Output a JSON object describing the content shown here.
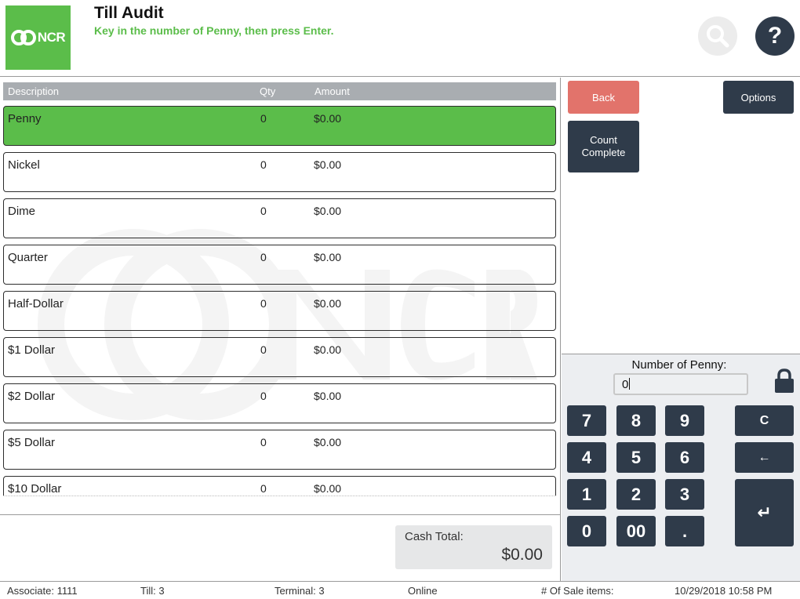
{
  "header": {
    "logo_text": "NCR",
    "title": "Till Audit",
    "subtitle": "Key in the number of Penny, then press Enter.",
    "search_icon": "search-icon",
    "help_label": "?"
  },
  "colors": {
    "brand_green": "#5bbd4a",
    "dark_button": "#2f3b4a",
    "back_button": "#e2736b"
  },
  "table": {
    "headers": {
      "description": "Description",
      "qty": "Qty",
      "amount": "Amount"
    },
    "rows": [
      {
        "description": "Penny",
        "qty": "0",
        "amount": "$0.00",
        "selected": true
      },
      {
        "description": "Nickel",
        "qty": "0",
        "amount": "$0.00"
      },
      {
        "description": "Dime",
        "qty": "0",
        "amount": "$0.00"
      },
      {
        "description": "Quarter",
        "qty": "0",
        "amount": "$0.00"
      },
      {
        "description": "Half-Dollar",
        "qty": "0",
        "amount": "$0.00"
      },
      {
        "description": "$1 Dollar",
        "qty": "0",
        "amount": "$0.00"
      },
      {
        "description": "$2 Dollar",
        "qty": "0",
        "amount": "$0.00"
      },
      {
        "description": "$5 Dollar",
        "qty": "0",
        "amount": "$0.00"
      },
      {
        "description": "$10 Dollar",
        "qty": "0",
        "amount": "$0.00"
      }
    ]
  },
  "totals": {
    "label": "Cash Total:",
    "value": "$0.00"
  },
  "actions": {
    "back": "Back",
    "options": "Options",
    "count_complete": "Count\nComplete"
  },
  "keypad": {
    "label": "Number of Penny:",
    "input_value": "0",
    "keys": {
      "k7": "7",
      "k8": "8",
      "k9": "9",
      "k4": "4",
      "k5": "5",
      "k6": "6",
      "k1": "1",
      "k2": "2",
      "k3": "3",
      "k0": "0",
      "k00": "00",
      "kdot": ".",
      "clear": "C",
      "backspace": "←",
      "enter": "↵"
    }
  },
  "status": {
    "associate": "Associate: 1111",
    "till": "Till: 3",
    "terminal": "Terminal: 3",
    "online": "Online",
    "sale_items": "# Of Sale items:",
    "datetime": "10/29/2018 10:58 PM"
  }
}
